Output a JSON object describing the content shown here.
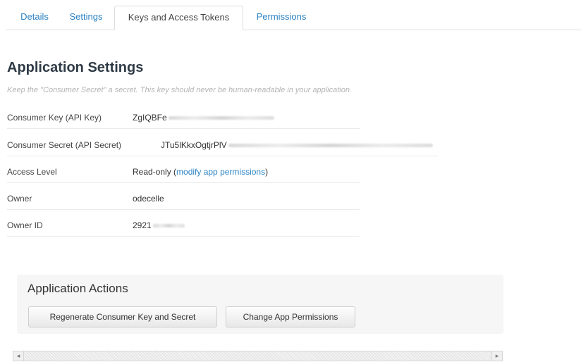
{
  "tabs": [
    {
      "label": "Details",
      "active": false
    },
    {
      "label": "Settings",
      "active": false
    },
    {
      "label": "Keys and Access Tokens",
      "active": true
    },
    {
      "label": "Permissions",
      "active": false
    }
  ],
  "app_settings": {
    "title": "Application Settings",
    "subtitle": "Keep the \"Consumer Secret\" a secret. This key should never be human-readable in your application.",
    "consumer_key": {
      "label": "Consumer Key (API Key)",
      "value": "ZgIQBFe"
    },
    "consumer_secret": {
      "label": "Consumer Secret (API Secret)",
      "value": "JTu5lKkxOgtjrPlV"
    },
    "access_level": {
      "label": "Access Level",
      "value": "Read-only (",
      "link": "modify app permissions",
      "suffix": ")"
    },
    "owner": {
      "label": "Owner",
      "value": "odecelle"
    },
    "owner_id": {
      "label": "Owner ID",
      "value": "2921"
    }
  },
  "actions": {
    "title": "Application Actions",
    "regenerate_label": "Regenerate Consumer Key and Secret",
    "change_permissions_label": "Change App Permissions"
  },
  "scrollbar": {
    "left_arrow": "◂",
    "right_arrow": "▸"
  },
  "colors": {
    "link": "#2d83c4",
    "heading": "#2f3b46",
    "subtitle": "#b4b4b4",
    "panel": "#f6f6f6"
  },
  "icons": [
    "scroll-left-arrow-icon",
    "scroll-right-arrow-icon"
  ]
}
